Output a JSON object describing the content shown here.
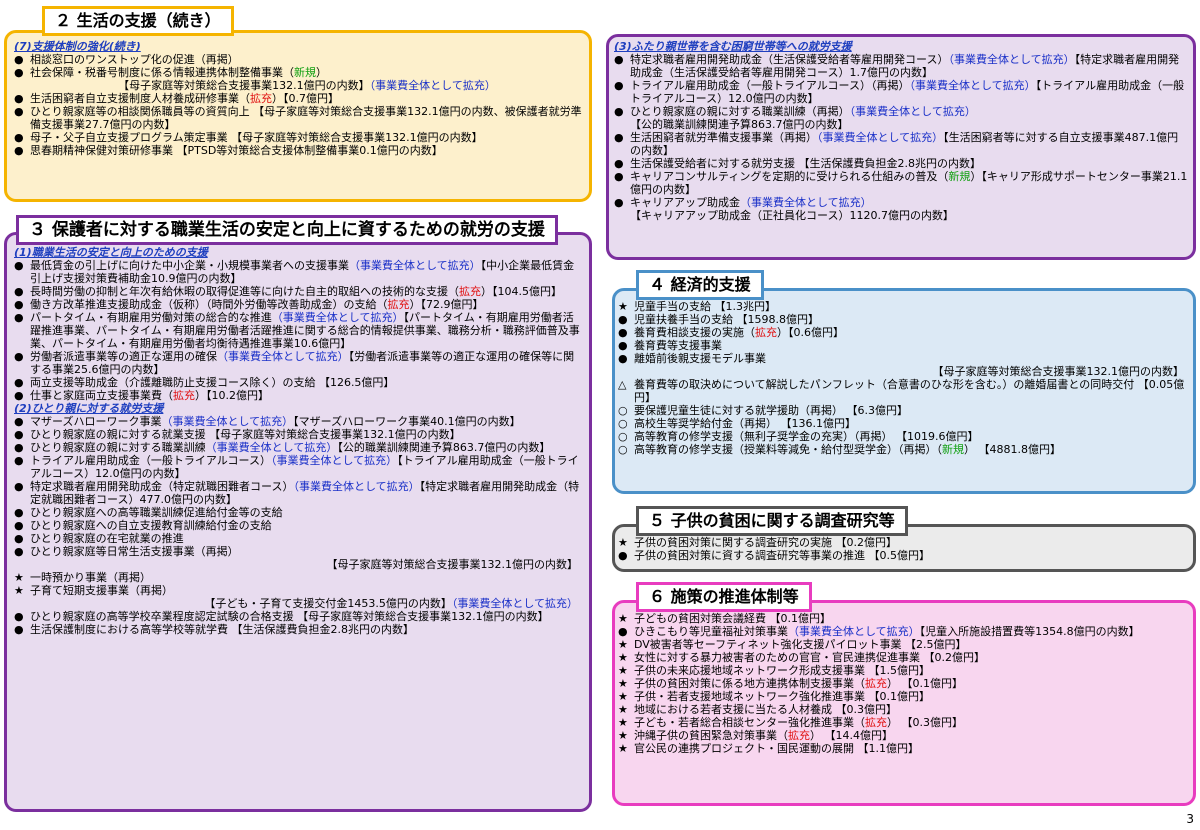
{
  "s2": {
    "title": "２ 生活の支援（続き）",
    "sub": "(7)支援体制の強化(続き)",
    "items": [
      {
        "m": "●",
        "p": [
          {
            "t": "相談窓口のワンストップ化の促進（再掲）"
          }
        ]
      },
      {
        "m": "●",
        "p": [
          {
            "t": "社会保障・税番号制度に係る情報連携体制整備事業（"
          },
          {
            "t": "新規",
            "c": "green"
          },
          {
            "t": "）"
          }
        ]
      },
      {
        "m": "",
        "cls": "center",
        "p": [
          {
            "t": "【母子家庭等対策総合支援事業132.1億円の内数】"
          },
          {
            "t": "（事業費全体として拡充）",
            "c": "blue"
          }
        ]
      },
      {
        "m": "●",
        "p": [
          {
            "t": "生活困窮者自立支援制度人材養成研修事業（"
          },
          {
            "t": "拡充",
            "c": "red"
          },
          {
            "t": "）【0.7億円】"
          }
        ]
      },
      {
        "m": "●",
        "p": [
          {
            "t": "ひとり親家庭等の相談関係職員等の資質向上 【母子家庭等対策総合支援事業132.1億円の内数、被保護者就労準備支援事業27.7億円の内数】"
          }
        ]
      },
      {
        "m": "●",
        "p": [
          {
            "t": "母子・父子自立支援プログラム策定事業 【母子家庭等対策総合支援事業132.1億円の内数】"
          }
        ]
      },
      {
        "m": "●",
        "p": [
          {
            "t": "思春期精神保健対策研修事業 【PTSD等対策総合支援体制整備事業0.1億円の内数】"
          }
        ]
      }
    ]
  },
  "s3": {
    "title": "３ 保護者に対する職業生活の安定と向上に資するための就労の支援",
    "sub1": "(1)職業生活の安定と向上のための支援",
    "items1": [
      {
        "m": "●",
        "p": [
          {
            "t": "最低賃金の引上げに向けた中小企業・小規模事業者への支援事業"
          },
          {
            "t": "（事業費全体として拡充）",
            "c": "blue"
          },
          {
            "t": "【中小企業最低賃金引上げ支援対策費補助金10.9億円の内数】"
          }
        ]
      },
      {
        "m": "●",
        "p": [
          {
            "t": "長時間労働の抑制と年次有給休暇の取得促進等に向けた自主的取組への技術的な支援（"
          },
          {
            "t": "拡充",
            "c": "red"
          },
          {
            "t": "）【104.5億円】"
          }
        ]
      },
      {
        "m": "●",
        "p": [
          {
            "t": "働き方改革推進支援助成金（仮称）（時間外労働等改善助成金）の支給（"
          },
          {
            "t": "拡充",
            "c": "red"
          },
          {
            "t": "）【72.9億円】"
          }
        ]
      },
      {
        "m": "●",
        "p": [
          {
            "t": "パートタイム・有期雇用労働対策の総合的な推進"
          },
          {
            "t": "（事業費全体として拡充）",
            "c": "blue"
          },
          {
            "t": "【パートタイム・有期雇用労働者活躍推進事業、パートタイム・有期雇用労働者活躍推進に関する総合的情報提供事業、職務分析・職務評価普及事業、パートタイム・有期雇用労働者均衡待遇推進事業10.6億円】"
          }
        ]
      },
      {
        "m": "●",
        "p": [
          {
            "t": "労働者派遣事業等の適正な運用の確保"
          },
          {
            "t": "（事業費全体として拡充）",
            "c": "blue"
          },
          {
            "t": "【労働者派遣事業等の適正な運用の確保等に関する事業25.6億円の内数】"
          }
        ]
      },
      {
        "m": "●",
        "p": [
          {
            "t": "両立支援等助成金（介護離職防止支援コース除く）の支給 【126.5億円】"
          }
        ]
      },
      {
        "m": "●",
        "p": [
          {
            "t": "仕事と家庭両立支援事業費（"
          },
          {
            "t": "拡充",
            "c": "red"
          },
          {
            "t": "）【10.2億円】"
          }
        ]
      }
    ],
    "sub2": "(2)ひとり親に対する就労支援",
    "items2": [
      {
        "m": "●",
        "p": [
          {
            "t": "マザーズハローワーク事業"
          },
          {
            "t": "（事業費全体として拡充）",
            "c": "blue"
          },
          {
            "t": "【マザーズハローワーク事業40.1億円の内数】"
          }
        ]
      },
      {
        "m": "●",
        "p": [
          {
            "t": "ひとり親家庭の親に対する就業支援 【母子家庭等対策総合支援事業132.1億円の内数】"
          }
        ]
      },
      {
        "m": "●",
        "p": [
          {
            "t": "ひとり親家庭の親に対する職業訓練"
          },
          {
            "t": "（事業費全体として拡充）",
            "c": "blue"
          },
          {
            "t": "【公的職業訓練関連予算863.7億円の内数】"
          }
        ]
      },
      {
        "m": "●",
        "p": [
          {
            "t": "トライアル雇用助成金（一般トライアルコース）"
          },
          {
            "t": "（事業費全体として拡充）",
            "c": "blue"
          },
          {
            "t": "【トライアル雇用助成金（一般トライアルコース）12.0億円の内数】"
          }
        ]
      },
      {
        "m": "●",
        "p": [
          {
            "t": "特定求職者雇用開発助成金（特定就職困難者コース）"
          },
          {
            "t": "（事業費全体として拡充）",
            "c": "blue"
          },
          {
            "t": "【特定求職者雇用開発助成金（特定就職困難者コース）477.0億円の内数】"
          }
        ]
      },
      {
        "m": "●",
        "p": [
          {
            "t": "ひとり親家庭への高等職業訓練促進給付金等の支給"
          }
        ]
      },
      {
        "m": "●",
        "p": [
          {
            "t": "ひとり親家庭への自立支援教育訓練給付金の支給"
          }
        ]
      },
      {
        "m": "●",
        "p": [
          {
            "t": "ひとり親家庭の在宅就業の推進"
          }
        ]
      },
      {
        "m": "●",
        "p": [
          {
            "t": "ひとり親家庭等日常生活支援事業（再掲）"
          }
        ]
      },
      {
        "m": "",
        "cls": "right",
        "p": [
          {
            "t": "【母子家庭等対策総合支援事業132.1億円の内数】"
          }
        ]
      },
      {
        "m": "★",
        "p": [
          {
            "t": "一時預かり事業（再掲）"
          }
        ]
      },
      {
        "m": "★",
        "p": [
          {
            "t": "子育て短期支援事業（再掲）"
          }
        ]
      },
      {
        "m": "",
        "cls": "right",
        "p": [
          {
            "t": "【子ども・子育て支援交付金1453.5億円の内数】"
          },
          {
            "t": "（事業費全体として拡充）",
            "c": "blue"
          }
        ]
      },
      {
        "m": "●",
        "p": [
          {
            "t": "ひとり親家庭の高等学校卒業程度認定試験の合格支援 【母子家庭等対策総合支援事業132.1億円の内数】"
          }
        ]
      },
      {
        "m": "●",
        "p": [
          {
            "t": "生活保護制度における高等学校等就学費 【生活保護費負担金2.8兆円の内数】"
          }
        ]
      }
    ]
  },
  "s3b": {
    "sub": "(3)ふたり親世帯を含む困窮世帯等への就労支援",
    "items": [
      {
        "m": "●",
        "p": [
          {
            "t": "特定求職者雇用開発助成金（生活保護受給者等雇用開発コース）"
          },
          {
            "t": "（事業費全体として拡充）",
            "c": "blue"
          },
          {
            "t": "【特定求職者雇用開発助成金（生活保護受給者等雇用開発コース）1.7億円の内数】"
          }
        ]
      },
      {
        "m": "●",
        "p": [
          {
            "t": "トライアル雇用助成金（一般トライアルコース）（再掲）"
          },
          {
            "t": "（事業費全体として拡充）",
            "c": "blue"
          },
          {
            "t": "【トライアル雇用助成金（一般トライアルコース）12.0億円の内数】"
          }
        ]
      },
      {
        "m": "●",
        "p": [
          {
            "t": "ひとり親家庭の親に対する職業訓練（再掲）"
          },
          {
            "t": "（事業費全体として拡充）",
            "c": "blue"
          },
          {
            "t": "【公的職業訓練関連予算863.7億円の内数】"
          }
        ]
      },
      {
        "m": "●",
        "p": [
          {
            "t": "生活困窮者就労準備支援事業（再掲）"
          },
          {
            "t": "（事業費全体として拡充）",
            "c": "blue"
          },
          {
            "t": "【生活困窮者等に対する自立支援事業487.1億円の内数】"
          }
        ]
      },
      {
        "m": "●",
        "p": [
          {
            "t": "生活保護受給者に対する就労支援 【生活保護費負担金2.8兆円の内数】"
          }
        ]
      },
      {
        "m": "●",
        "p": [
          {
            "t": "キャリアコンサルティングを定期的に受けられる仕組みの普及（"
          },
          {
            "t": "新規",
            "c": "green"
          },
          {
            "t": "）【キャリア形成サポートセンター事業21.1億円の内数】"
          }
        ]
      },
      {
        "m": "●",
        "p": [
          {
            "t": "キャリアアップ助成金"
          },
          {
            "t": "（事業費全体として拡充）",
            "c": "blue"
          },
          {
            "t": "【キャリアアップ助成金（正社員化コース）1120.7億円の内数】"
          }
        ]
      }
    ]
  },
  "s4": {
    "title": "４ 経済的支援",
    "items": [
      {
        "m": "★",
        "p": [
          {
            "t": "児童手当の支給 【1.3兆円】"
          }
        ]
      },
      {
        "m": "●",
        "p": [
          {
            "t": "児童扶養手当の支給 【1598.8億円】"
          }
        ]
      },
      {
        "m": "●",
        "p": [
          {
            "t": "養育費相談支援の実施（"
          },
          {
            "t": "拡充",
            "c": "red"
          },
          {
            "t": "）【0.6億円】"
          }
        ]
      },
      {
        "m": "●",
        "p": [
          {
            "t": "養育費等支援事業"
          }
        ]
      },
      {
        "m": "●",
        "p": [
          {
            "t": "離婚前後親支援モデル事業"
          }
        ]
      },
      {
        "m": "",
        "cls": "right",
        "p": [
          {
            "t": "【母子家庭等対策総合支援事業132.1億円の内数】"
          }
        ]
      },
      {
        "m": "△",
        "p": [
          {
            "t": "養育費等の取決めについて解説したパンフレット（合意書のひな形を含む。）の離婚届書との同時交付 【0.05億円】"
          }
        ]
      },
      {
        "m": "○",
        "p": [
          {
            "t": "要保護児童生徒に対する就学援助（再掲） 【6.3億円】"
          }
        ]
      },
      {
        "m": "○",
        "p": [
          {
            "t": "高校生等奨学給付金（再掲） 【136.1億円】"
          }
        ]
      },
      {
        "m": "○",
        "p": [
          {
            "t": "高等教育の修学支援（無利子奨学金の充実）（再掲） 【1019.6億円】"
          }
        ]
      },
      {
        "m": "○",
        "p": [
          {
            "t": "高等教育の修学支援（授業料等減免・給付型奨学金）（再掲）（"
          },
          {
            "t": "新規",
            "c": "green"
          },
          {
            "t": "） 【4881.8億円】"
          }
        ]
      }
    ]
  },
  "s5": {
    "title": "５ 子供の貧困に関する調査研究等",
    "items": [
      {
        "m": "★",
        "p": [
          {
            "t": "子供の貧困対策に関する調査研究の実施 【0.2億円】"
          }
        ]
      },
      {
        "m": "●",
        "p": [
          {
            "t": "子供の貧困対策に資する調査研究等事業の推進 【0.5億円】"
          }
        ]
      }
    ]
  },
  "s6": {
    "title": "６ 施策の推進体制等",
    "items": [
      {
        "m": "★",
        "p": [
          {
            "t": "子どもの貧困対策会議経費 【0.1億円】"
          }
        ]
      },
      {
        "m": "●",
        "p": [
          {
            "t": "ひきこもり等児童福祉対策事業"
          },
          {
            "t": "（事業費全体として拡充）",
            "c": "blue"
          },
          {
            "t": "【児童入所施設措置費等1354.8億円の内数】"
          }
        ]
      },
      {
        "m": "★",
        "p": [
          {
            "t": "DV被害者等セーフティネット強化支援パイロット事業 【2.5億円】"
          }
        ]
      },
      {
        "m": "★",
        "p": [
          {
            "t": "女性に対する暴力被害者のための官官・官民連携促進事業 【0.2億円】"
          }
        ]
      },
      {
        "m": "★",
        "p": [
          {
            "t": "子供の未来応援地域ネットワーク形成支援事業 【1.5億円】"
          }
        ]
      },
      {
        "m": "★",
        "p": [
          {
            "t": "子供の貧困対策に係る地方連携体制支援事業（"
          },
          {
            "t": "拡充",
            "c": "red"
          },
          {
            "t": "） 【0.1億円】"
          }
        ]
      },
      {
        "m": "★",
        "p": [
          {
            "t": "子供・若者支援地域ネットワーク強化推進事業 【0.1億円】"
          }
        ]
      },
      {
        "m": "★",
        "p": [
          {
            "t": "地域における若者支援に当たる人材養成 【0.3億円】"
          }
        ]
      },
      {
        "m": "★",
        "p": [
          {
            "t": "子ども・若者総合相談センター強化推進事業（"
          },
          {
            "t": "拡充",
            "c": "red"
          },
          {
            "t": "） 【0.3億円】"
          }
        ]
      },
      {
        "m": "★",
        "p": [
          {
            "t": "沖縄子供の貧困緊急対策事業（"
          },
          {
            "t": "拡充",
            "c": "red"
          },
          {
            "t": "） 【14.4億円】"
          }
        ]
      },
      {
        "m": "★",
        "p": [
          {
            "t": "官公民の連携プロジェクト・国民運動の展開 【1.1億円】"
          }
        ]
      }
    ]
  },
  "page_number": "3"
}
